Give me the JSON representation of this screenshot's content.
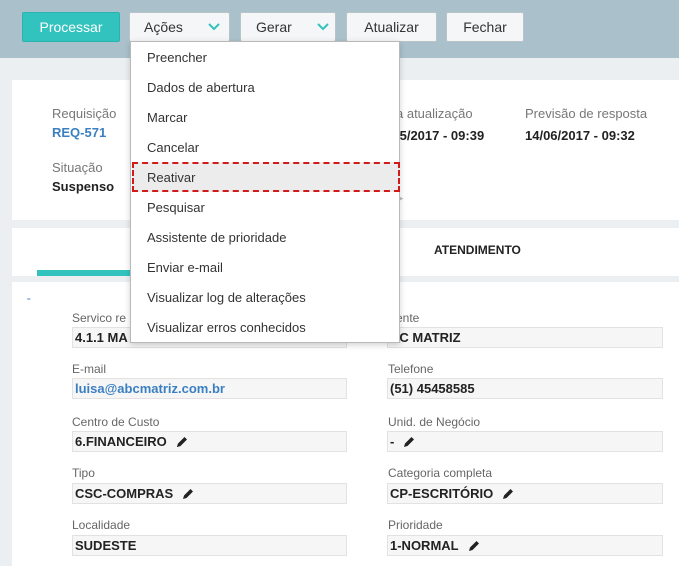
{
  "toolbar": {
    "processar": "Processar",
    "acoes": "Ações",
    "gerar": "Gerar",
    "atualizar": "Atualizar",
    "fechar": "Fechar"
  },
  "menu": {
    "items": [
      "Preencher",
      "Dados de abertura",
      "Marcar",
      "Cancelar",
      "Reativar",
      "Pesquisar",
      "Assistente de prioridade",
      "Enviar e-mail",
      "Visualizar log de alterações",
      "Visualizar erros conhecidos"
    ],
    "highlighted": "Reativar"
  },
  "header": {
    "requisicao_label": "Requisição",
    "requisicao_value": "REQ-571",
    "situacao_label": "Situação",
    "situacao_value": "Suspenso",
    "atualizacao_label": "a atualização",
    "atualizacao_value": "/5/2017 - 09:39",
    "previsao_label": "Previsão de resposta",
    "previsao_value": "14/06/2017 - 09:32"
  },
  "tabs": {
    "atendimento": "ATENDIMENTO"
  },
  "form": {
    "collapse_mark": "-",
    "servico_label": "Servico re",
    "servico_value": "4.1.1 MA",
    "cliente_label": "ente",
    "cliente_value": "BC MATRIZ",
    "email_label": "E-mail",
    "email_value": "luisa@abcmatriz.com.br",
    "telefone_label": "Telefone",
    "telefone_value": "(51) 45458585",
    "centro_label": "Centro de Custo",
    "centro_value": "6.FINANCEIRO",
    "unid_label": "Unid. de Negócio",
    "unid_value": "-",
    "tipo_label": "Tipo",
    "tipo_value": "CSC-COMPRAS",
    "categoria_label": "Categoria completa",
    "categoria_value": "CP-ESCRITÓRIO",
    "localidade_label": "Localidade",
    "localidade_value": "SUDESTE",
    "prioridade_label": "Prioridade",
    "prioridade_value": "1-NORMAL"
  },
  "colors": {
    "primary": "#33c3bf",
    "topbar": "#aac1cc",
    "link": "#3a7fc2",
    "highlight_outline": "#d11a1a"
  }
}
